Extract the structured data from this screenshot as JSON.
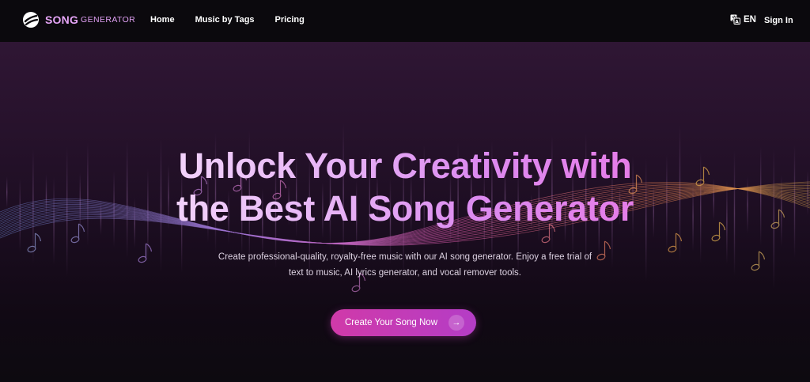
{
  "brand": {
    "name": "SONG",
    "sub": "GENERATOR"
  },
  "nav": {
    "items": [
      {
        "label": "Home"
      },
      {
        "label": "Music by Tags"
      },
      {
        "label": "Pricing"
      }
    ]
  },
  "header": {
    "language": "EN",
    "sign_in": "Sign In"
  },
  "hero": {
    "title_line1": "Unlock Your Creativity with",
    "title_line2": "the Best AI Song Generator",
    "description": "Create professional-quality, royalty-free music with our AI song generator. Enjoy a free trial of text to music, AI lyrics generator, and vocal remover tools.",
    "cta_label": "Create Your Song Now"
  },
  "colors": {
    "accent": "#d03aa9",
    "accent_2": "#b43dc6",
    "brand_text": "#e6a5f7",
    "background": "#0b090d"
  },
  "icons": {
    "logo": "vinyl-logo-icon",
    "language": "translate-icon",
    "cta": "arrow-right-icon"
  }
}
